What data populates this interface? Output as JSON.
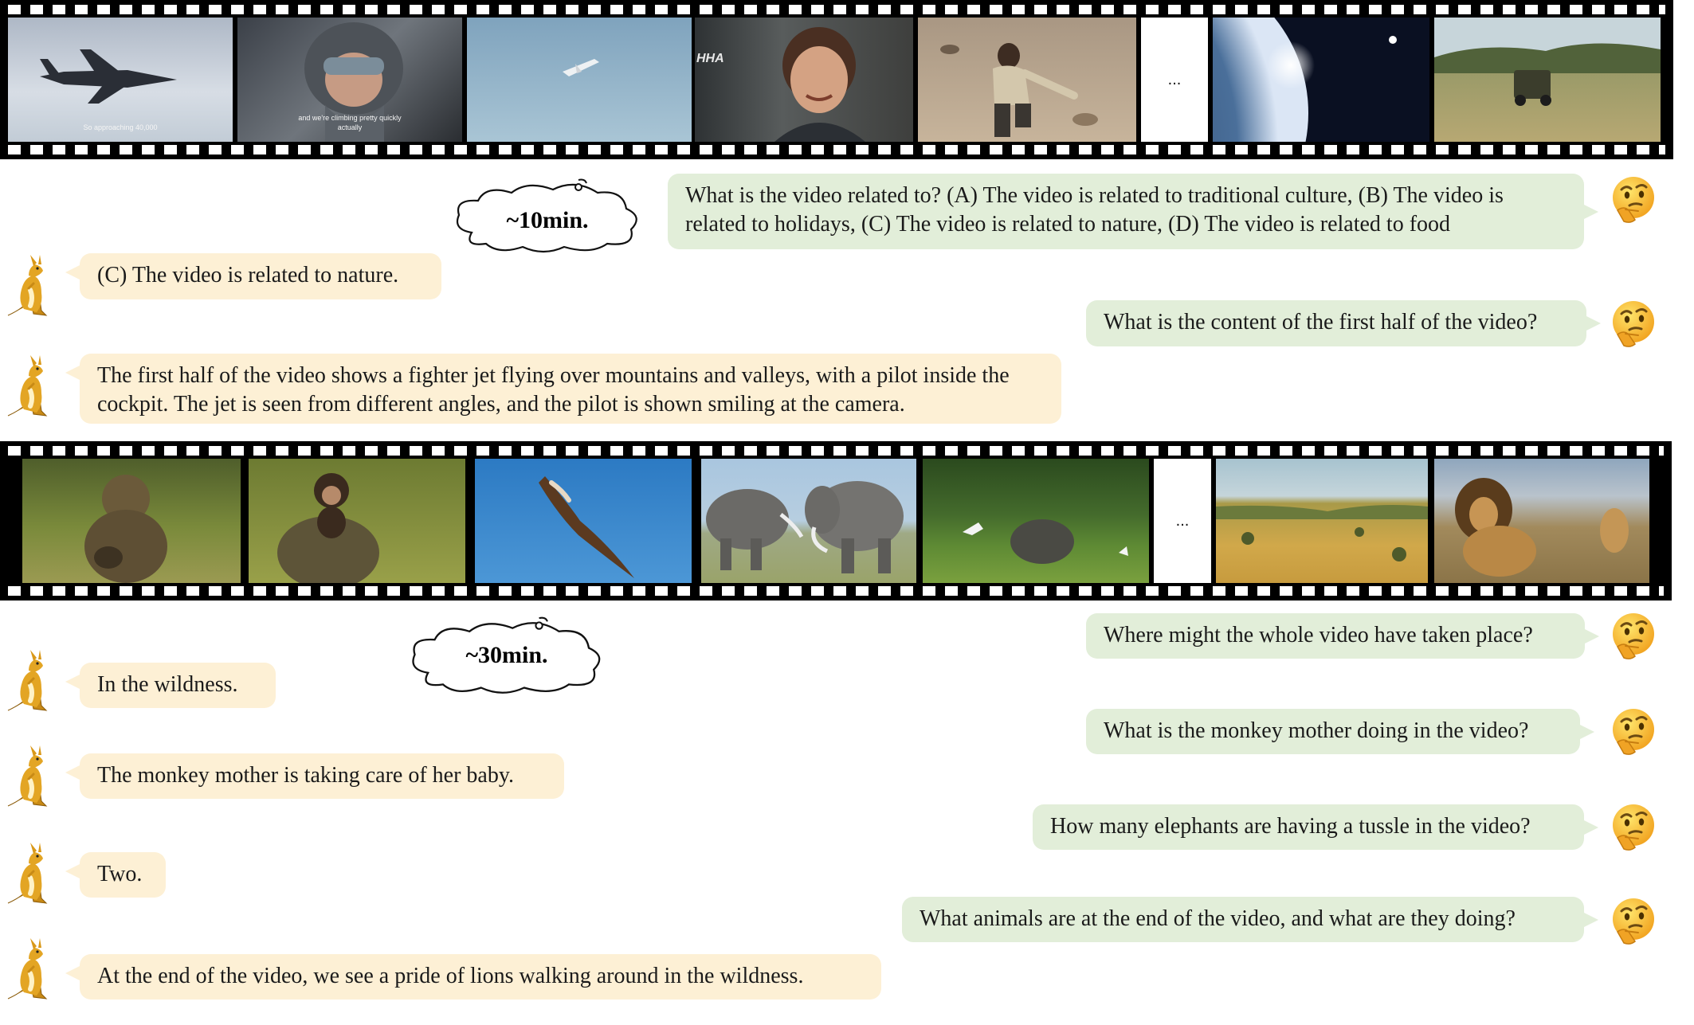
{
  "strip1": {
    "ellipsis": "...",
    "captions": {
      "frame1": "So approaching 40,000",
      "frame2": "and we're climbing pretty quickly actually",
      "frame4": "HHA"
    }
  },
  "strip2": {
    "ellipsis": "..."
  },
  "clouds": {
    "first": "~10min.",
    "second": "~30min."
  },
  "conversation1": [
    {
      "role": "user",
      "text": "What is the video related to? (A) The video is related to traditional culture, (B) The video is related to holidays, (C) The video is related to nature, (D) The video is related to food"
    },
    {
      "role": "assistant",
      "text": "(C) The video is related to nature."
    },
    {
      "role": "user",
      "text": "What is the content of the first half of the video?"
    },
    {
      "role": "assistant",
      "text": "The first half of the video shows a fighter jet flying over mountains and valleys, with a pilot inside the cockpit. The jet is seen from different angles, and the pilot is shown smiling at the camera."
    }
  ],
  "conversation2": [
    {
      "role": "user",
      "text": "Where might the whole video have taken place?"
    },
    {
      "role": "assistant",
      "text": "In the wildness."
    },
    {
      "role": "user",
      "text": "What is the monkey mother doing in the video?"
    },
    {
      "role": "assistant",
      "text": "The monkey mother is taking care of her baby."
    },
    {
      "role": "user",
      "text": "How many elephants are having a tussle in the video?"
    },
    {
      "role": "assistant",
      "text": "Two."
    },
    {
      "role": "user",
      "text": "What animals are at the end of the video, and what are they doing?"
    },
    {
      "role": "assistant",
      "text": "At the end of the video, we see a pride of lions walking around in the wildness."
    }
  ],
  "icons": {
    "user": "thinking-face-icon",
    "assistant": "kangaroo-icon",
    "cloud": "thought-cloud-icon"
  }
}
